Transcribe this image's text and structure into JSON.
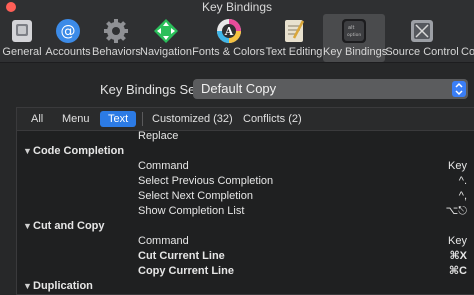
{
  "window": {
    "title": "Key Bindings"
  },
  "toolbar": {
    "items": [
      {
        "label": "General",
        "icon": "general-icon",
        "color": "#c9c9cc"
      },
      {
        "label": "Accounts",
        "icon": "at-sign-icon",
        "color": "#3c8be8"
      },
      {
        "label": "Behaviors",
        "icon": "gear-icon",
        "color": "#8f9094"
      },
      {
        "label": "Navigation",
        "icon": "navigation-arrows-icon",
        "color": "#2bbf5a"
      },
      {
        "label": "Fonts & Colors",
        "icon": "font-a-icon",
        "color": "#e0e0e0"
      },
      {
        "label": "Text Editing",
        "icon": "text-editing-icon",
        "color": "#e8e1cf"
      },
      {
        "label": "Key Bindings",
        "icon": "keyboard-key-icon",
        "color": "#6b6c70"
      },
      {
        "label": "Source Control",
        "icon": "source-control-icon",
        "color": "#9da0a6"
      },
      {
        "label": "Co",
        "icon": "components-icon",
        "color": "#c8c8c8"
      }
    ]
  },
  "key_bindings_set": {
    "label": "Key Bindings Set",
    "value": "Default Copy"
  },
  "filters": {
    "all": "All",
    "menu": "Menu",
    "text": "Text",
    "customized": "Customized (32)",
    "conflicts": "Conflicts (2)"
  },
  "rows": [
    {
      "type": "item",
      "command": "Replace",
      "key": ""
    },
    {
      "type": "group",
      "command": "Code Completion",
      "key": ""
    },
    {
      "type": "header",
      "command": "Command",
      "key": "Key"
    },
    {
      "type": "item",
      "command": "Select Previous Completion",
      "key": "^."
    },
    {
      "type": "item",
      "command": "Select Next Completion",
      "key": "^,"
    },
    {
      "type": "item",
      "command": "Show Completion List",
      "key": "⌥⎋"
    },
    {
      "type": "group",
      "command": "Cut and Copy",
      "key": ""
    },
    {
      "type": "header",
      "command": "Command",
      "key": "Key"
    },
    {
      "type": "bold",
      "command": "Cut Current Line",
      "key": "⌘X"
    },
    {
      "type": "bold",
      "command": "Copy Current Line",
      "key": "⌘C"
    },
    {
      "type": "group",
      "command": "Duplication",
      "key": ""
    }
  ],
  "colors": {
    "accent": "#2c7be5",
    "window_bg": "#272829"
  }
}
